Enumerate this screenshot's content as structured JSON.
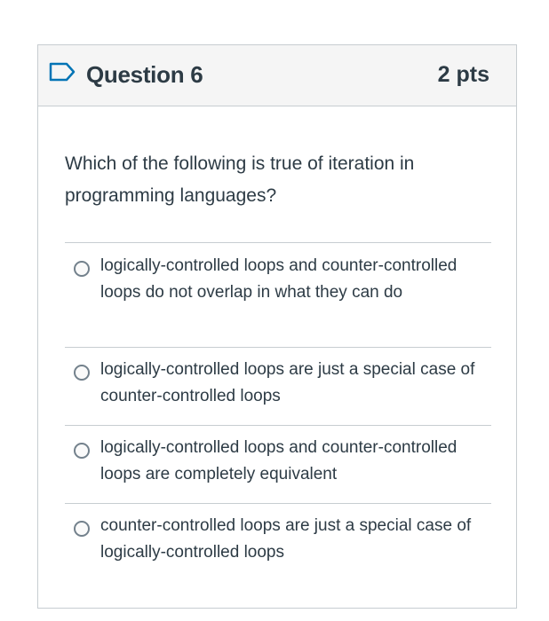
{
  "question": {
    "title": "Question 6",
    "points": "2 pts",
    "icon": "bookmark-flag-icon",
    "body": "Which of the following is true of iteration in programming languages?"
  },
  "answers": [
    {
      "label": "logically-controlled loops and counter-controlled loops do not overlap in what they can do",
      "selected": false
    },
    {
      "label": "logically-controlled loops are just a special case of counter-controlled loops",
      "selected": false
    },
    {
      "label": "logically-controlled loops and counter-controlled loops are completely equivalent",
      "selected": false
    },
    {
      "label": "counter-controlled loops are just a special case of logically-controlled loops",
      "selected": false
    }
  ],
  "colors": {
    "text": "#2d3b45",
    "border": "#c7cdd1",
    "header_bg": "#f5f5f5",
    "flag": "#0374b5"
  }
}
